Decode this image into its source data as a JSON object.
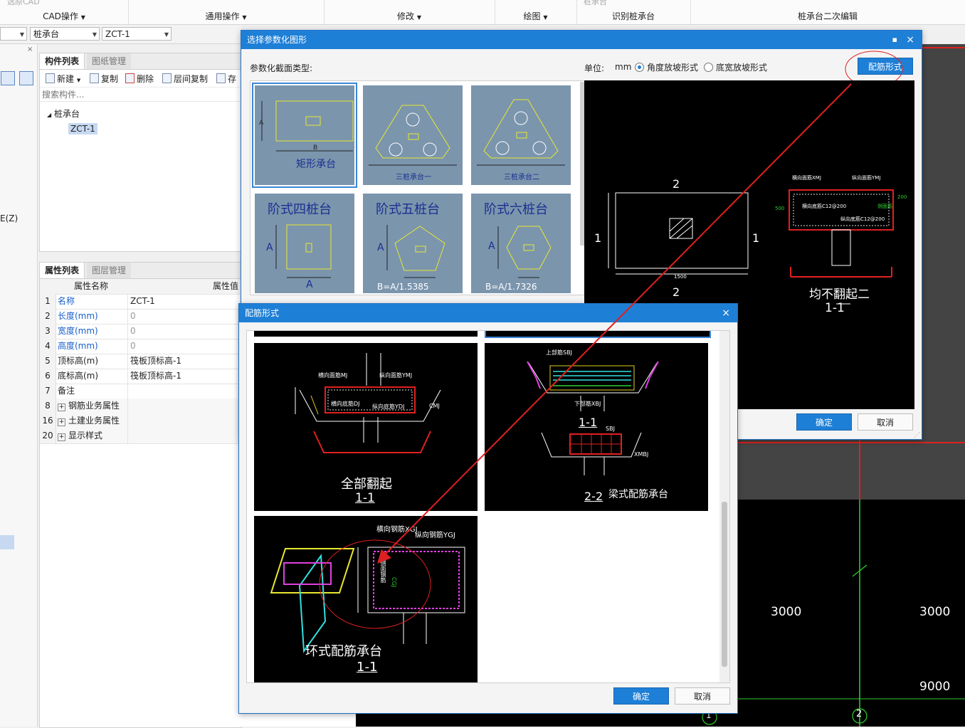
{
  "ribbon": {
    "groups": [
      {
        "label": "CAD操作",
        "hint": "选原CAD"
      },
      {
        "label": "通用操作",
        "hint": ""
      },
      {
        "label": "修改",
        "hint": ""
      },
      {
        "label": "绘图",
        "hint": ""
      },
      {
        "label": "识别桩承台",
        "hint": "桩承台"
      },
      {
        "label": "桩承台二次编辑",
        "hint": ""
      }
    ]
  },
  "combobar": {
    "combo1": "",
    "combo2": "桩承台",
    "combo3": "ZCT-1"
  },
  "left_strip": {
    "shortcut": "E(Z)"
  },
  "component_panel": {
    "tabs": [
      "构件列表",
      "图纸管理"
    ],
    "toolbar": {
      "new": "新建",
      "copy": "复制",
      "delete": "删除",
      "floor_copy": "层间复制",
      "save": "存"
    },
    "search_placeholder": "搜索构件...",
    "tree": {
      "root": "桩承台",
      "child": "ZCT-1"
    }
  },
  "property_panel": {
    "tabs": [
      "属性列表",
      "图层管理"
    ],
    "headers": {
      "name": "属性名称",
      "value": "属性值"
    },
    "rows": [
      {
        "num": "1",
        "name": "名称",
        "value": "ZCT-1"
      },
      {
        "num": "2",
        "name": "长度(mm)",
        "value": "0"
      },
      {
        "num": "3",
        "name": "宽度(mm)",
        "value": "0"
      },
      {
        "num": "4",
        "name": "高度(mm)",
        "value": "0"
      },
      {
        "num": "5",
        "name": "顶标高(m)",
        "value": "筏板顶标高-1"
      },
      {
        "num": "6",
        "name": "底标高(m)",
        "value": "筏板顶标高-1"
      },
      {
        "num": "7",
        "name": "备注",
        "value": ""
      },
      {
        "num": "8",
        "name": "钢筋业务属性",
        "value": ""
      },
      {
        "num": "16",
        "name": "土建业务属性",
        "value": ""
      },
      {
        "num": "20",
        "name": "显示样式",
        "value": ""
      }
    ]
  },
  "cad": {
    "dim1": "3000",
    "dim2": "3000",
    "dim3": "9000",
    "axis1": "1",
    "axis2": "2"
  },
  "dialog1": {
    "title": "选择参数化图形",
    "section_label": "参数化截面类型:",
    "unit_label": "单位:",
    "unit_value": "mm",
    "radio1": "角度放坡形式",
    "radio2": "底宽放坡形式",
    "rebar_button": "配筋形式",
    "thumbs": [
      "矩形承台",
      "三桩承台一",
      "三桩承台二",
      "阶式四桩台",
      "阶式五桩台",
      "阶式六桩台"
    ],
    "thumb_formulas": [
      "",
      "",
      "",
      "A",
      "B=A/1.5385",
      "B=A/1.7326"
    ],
    "preview": {
      "num_2": "2",
      "num_1": "1",
      "dim_1500": "1500",
      "label_hx": "横向面筋XMJ",
      "label_zx": "纵向面筋YMJ",
      "label_hd": "横向底筋C12@200",
      "label_zd": "纵向底筋C12@200",
      "side_label": "侧面筋",
      "dim_500": "500",
      "dim_200": "200",
      "caption": "均不翻起二",
      "section": "1-1"
    },
    "ok": "确定",
    "cancel": "取消"
  },
  "dialog2": {
    "title": "配筋形式",
    "items": [
      {
        "caption": "全部翻起",
        "section": "1-1",
        "labels": [
          "横向面筋MJ",
          "纵向面筋YMJ",
          "横向底筋DJ",
          "纵向底筋YDJ",
          "CMJ"
        ]
      },
      {
        "caption": "梁式配筋承台",
        "section": "1-1",
        "section2": "2-2",
        "labels": [
          "上部筋SBJ",
          "下部筋XBJ",
          "SBJ",
          "XMBJ"
        ]
      },
      {
        "caption": "环式配筋承台",
        "section": "1-1",
        "labels": [
          "横向钢筋XGJ",
          "纵向钢筋YGJ",
          "侧面钢筋",
          "CGJ"
        ]
      }
    ],
    "ok": "确定",
    "cancel": "取消"
  },
  "colors": {
    "accent": "#1e7fd6",
    "annotation": "#e02020"
  }
}
